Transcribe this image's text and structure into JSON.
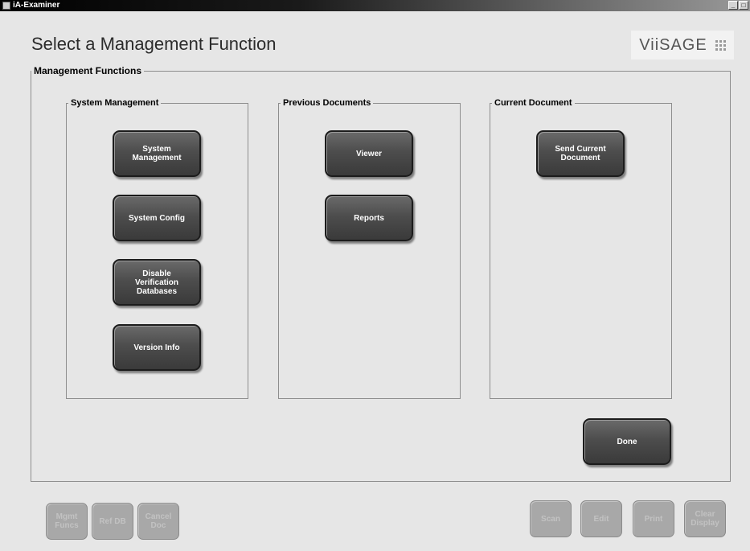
{
  "window": {
    "title": "iA-Examiner",
    "buttons": {
      "minimize": "_",
      "maximize": "□"
    }
  },
  "header": {
    "title": "Select a Management Function",
    "logo_text": "ViiSAGE"
  },
  "main_group": {
    "legend": "Management Functions"
  },
  "system_management": {
    "legend": "System Management",
    "buttons": {
      "system_management": "System\nManagement",
      "system_config": "System Config",
      "disable_verification": "Disable\nVerification\nDatabases",
      "version_info": "Version Info"
    }
  },
  "previous_documents": {
    "legend": "Previous Documents",
    "buttons": {
      "viewer": "Viewer",
      "reports": "Reports"
    }
  },
  "current_document": {
    "legend": "Current Document",
    "buttons": {
      "send_current": "Send Current\nDocument"
    }
  },
  "done_label": "Done",
  "bottom_left": {
    "mgmt_funcs": "Mgmt\nFuncs",
    "ref_db": "Ref DB",
    "cancel_doc": "Cancel\nDoc"
  },
  "bottom_right": {
    "scan": "Scan",
    "edit": "Edit",
    "print": "Print",
    "clear_display": "Clear\nDisplay"
  },
  "colors": {
    "button_dark": "#4d4d4d",
    "button_disabled": "#a8a8a8",
    "background": "#e6e6e6"
  }
}
